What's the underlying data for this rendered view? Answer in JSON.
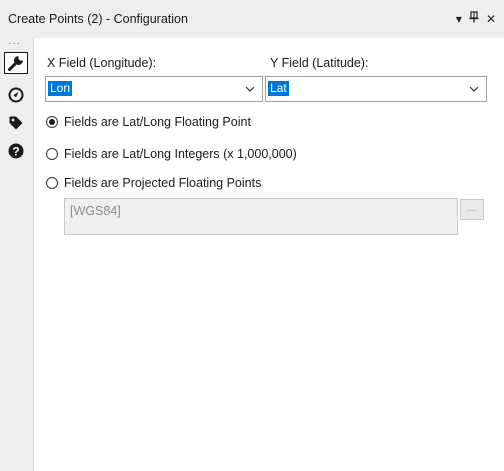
{
  "window": {
    "title": "Create Points (2) - Configuration",
    "buttons": {
      "dropdown": "▾",
      "pin": "⊥",
      "close": "✕"
    }
  },
  "sidebar": {
    "dots": "···",
    "items": [
      {
        "name": "configuration",
        "icon": "wrench-icon",
        "active": true
      },
      {
        "name": "layout",
        "icon": "compass-icon",
        "active": false
      },
      {
        "name": "annotation",
        "icon": "tag-icon",
        "active": false
      },
      {
        "name": "help",
        "icon": "help-icon",
        "active": false
      }
    ]
  },
  "fields": {
    "x_label": "X Field (Longitude):",
    "x_value": "Lon",
    "y_label": "Y Field (Latitude):",
    "y_value": "Lat"
  },
  "options": [
    {
      "label": "Fields are Lat/Long Floating Point",
      "checked": true
    },
    {
      "label": "Fields are Lat/Long Integers (x 1,000,000)",
      "checked": false
    },
    {
      "label": "Fields are Projected Floating Points",
      "checked": false
    }
  ],
  "projection": {
    "value": "[WGS84]",
    "button_label": "..."
  },
  "colors": {
    "selection": "#0078d7",
    "titlebar": "#eeeeee",
    "disabled_text": "#8a8a8a"
  }
}
